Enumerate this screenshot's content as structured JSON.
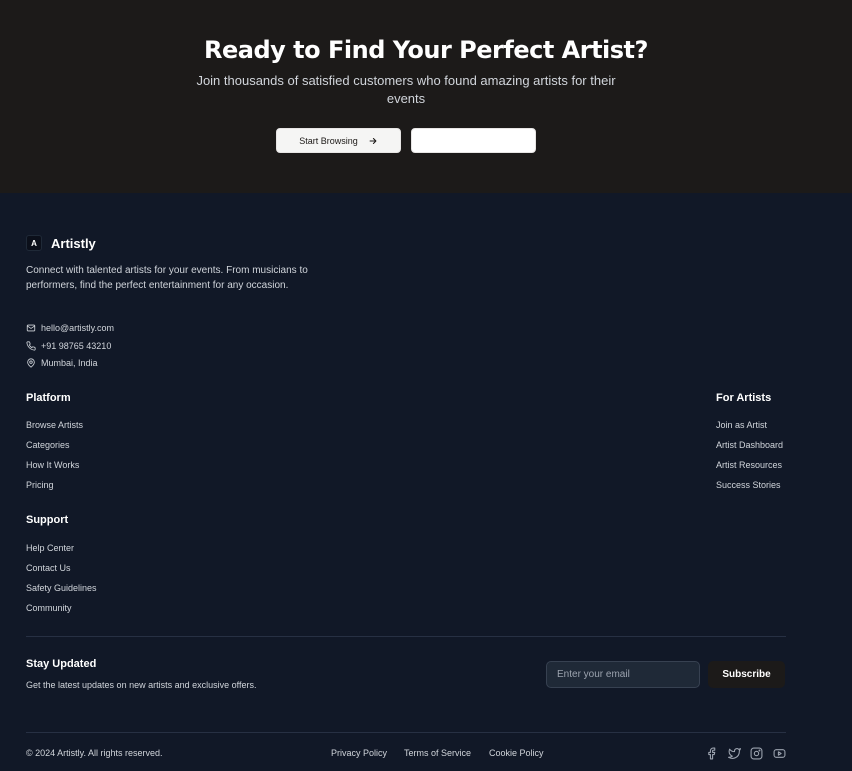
{
  "cta": {
    "title": "Ready to Find Your Perfect Artist?",
    "subtitle": "Join thousands of satisfied customers who found amazing artists for their events",
    "start_label": "Start Browsing",
    "second_label": ""
  },
  "brand": {
    "logo_letter": "A",
    "name": "Artistly",
    "description": "Connect with talented artists for your events. From musicians to performers, find the perfect entertainment for any occasion."
  },
  "contact": {
    "email": "hello@artistly.com",
    "phone": "+91 98765 43210",
    "location": "Mumbai, India"
  },
  "platform": {
    "title": "Platform",
    "links": [
      "Browse Artists",
      "Categories",
      "How It Works",
      "Pricing"
    ]
  },
  "for_artists": {
    "title": "For Artists",
    "links": [
      "Join as Artist",
      "Artist Dashboard",
      "Artist Resources",
      "Success Stories"
    ]
  },
  "support": {
    "title": "Support",
    "links": [
      "Help Center",
      "Contact Us",
      "Safety Guidelines",
      "Community"
    ]
  },
  "newsletter": {
    "title": "Stay Updated",
    "subtitle": "Get the latest updates on new artists and exclusive offers.",
    "placeholder": "Enter your email",
    "button": "Subscribe"
  },
  "bottom": {
    "copyright": "© 2024 Artistly. All rights reserved.",
    "legal": [
      "Privacy Policy",
      "Terms of Service",
      "Cookie Policy"
    ],
    "social_icons": [
      "facebook-icon",
      "twitter-icon",
      "instagram-icon",
      "youtube-icon"
    ]
  },
  "colors": {
    "cta_background": "#1c1a19",
    "footer_background": "#111827",
    "text": "#d1d5db"
  }
}
